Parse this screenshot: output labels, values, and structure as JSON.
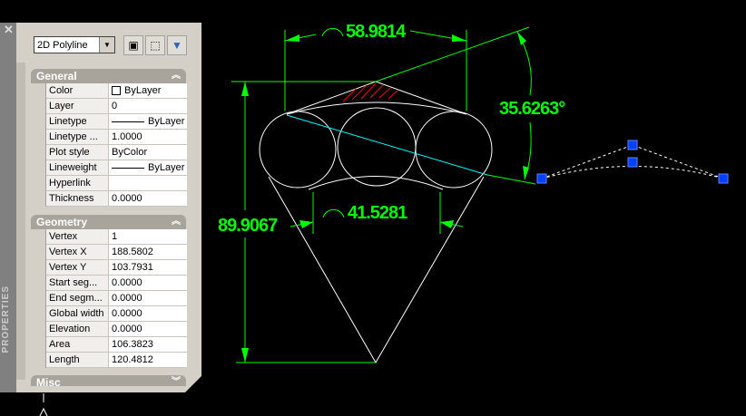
{
  "panel": {
    "title": "PROPERTIES",
    "close_icon": "close-icon",
    "object_type": "2D Polyline",
    "toolbar": [
      "quick-select-icon",
      "select-objects-icon",
      "toggle-pickadd-icon"
    ],
    "sections": [
      {
        "title": "General",
        "rows": [
          {
            "label": "Color",
            "value": "ByLayer"
          },
          {
            "label": "Layer",
            "value": "0"
          },
          {
            "label": "Linetype",
            "value": "ByLayer"
          },
          {
            "label": "Linetype ...",
            "value": "1.0000"
          },
          {
            "label": "Plot style",
            "value": "ByColor"
          },
          {
            "label": "Lineweight",
            "value": "ByLayer"
          },
          {
            "label": "Hyperlink",
            "value": ""
          },
          {
            "label": "Thickness",
            "value": "0.0000"
          }
        ]
      },
      {
        "title": "Geometry",
        "rows": [
          {
            "label": "Vertex",
            "value": "1"
          },
          {
            "label": "Vertex X",
            "value": "188.5802"
          },
          {
            "label": "Vertex Y",
            "value": "103.7931"
          },
          {
            "label": "Start seg...",
            "value": "0.0000"
          },
          {
            "label": "End segm...",
            "value": "0.0000"
          },
          {
            "label": "Global width",
            "value": "0.0000"
          },
          {
            "label": "Elevation",
            "value": "0.0000"
          },
          {
            "label": "Area",
            "value": "106.3823"
          },
          {
            "label": "Length",
            "value": "120.4812"
          }
        ]
      },
      {
        "title": "Misc",
        "rows": []
      }
    ]
  },
  "drawing": {
    "dim_top": "58.9814",
    "dim_bottom": "41.5281",
    "dim_height": "89.9067",
    "dim_angle": "35.6263°",
    "colors": {
      "dimension": "#00ff00",
      "geometry": "#ffffff",
      "selected": "#00ffff",
      "grip": "#0040ff",
      "hatch": "#ff0000"
    }
  }
}
